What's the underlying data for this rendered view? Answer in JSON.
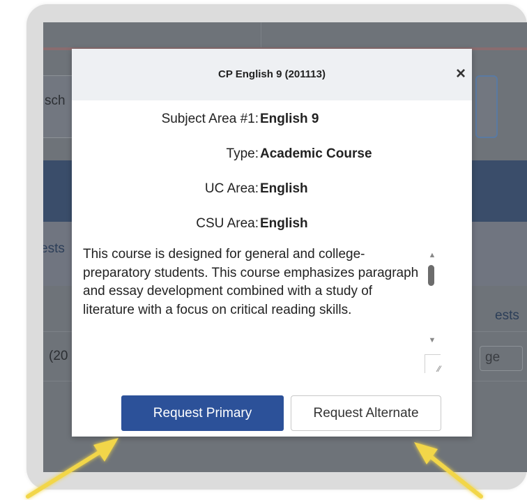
{
  "background": {
    "search_fragment": "sch",
    "left_fragment": "ests",
    "right_fragment": "ests",
    "row_fragment": "(20",
    "row_right_fragment": "ge"
  },
  "modal": {
    "title": "CP English 9 (201113)",
    "close_glyph": "×",
    "fields": [
      {
        "label": "Subject Area #1:",
        "value": "English 9"
      },
      {
        "label": "Type:",
        "value": "Academic Course"
      },
      {
        "label": "UC Area:",
        "value": "English"
      },
      {
        "label": "CSU Area:",
        "value": "English"
      }
    ],
    "description": "This course is designed for general and college-preparatory students. This course emphasizes paragraph and essay development combined with a study of literature with a focus on critical reading skills.",
    "buttons": {
      "primary_label": "Request Primary",
      "alternate_label": "Request Alternate"
    }
  },
  "colors": {
    "primary_button": "#2c5199",
    "highlight_arrow": "#f2d64a",
    "frame": "#dcdcdc"
  },
  "icons": {
    "close": "close-icon",
    "scroll_up": "scroll-up-icon",
    "scroll_down": "scroll-down-icon",
    "resize": "resize-handle-icon"
  }
}
